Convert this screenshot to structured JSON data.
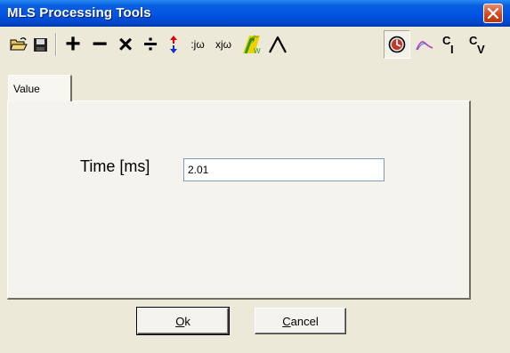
{
  "window": {
    "title": "MLS Processing Tools"
  },
  "toolbar": {
    "items": [
      {
        "name": "open-icon"
      },
      {
        "name": "save-icon"
      },
      {
        "name": "add-icon",
        "glyph": "+"
      },
      {
        "name": "subtract-icon",
        "glyph": "−"
      },
      {
        "name": "multiply-icon",
        "glyph": "×"
      },
      {
        "name": "divide-icon",
        "glyph": "÷"
      },
      {
        "name": "up-down-arrow-icon"
      },
      {
        "name": "divide-jw-icon",
        "glyph": ":jω"
      },
      {
        "name": "multiply-jw-icon",
        "glyph": "xjω"
      },
      {
        "name": "spl-weighting-icon",
        "glyph": "SPL W"
      },
      {
        "name": "window-curve-icon"
      },
      {
        "name": "time-clock-icon"
      },
      {
        "name": "smoothing-curve-icon"
      },
      {
        "name": "ci-icon",
        "glyph_top": "C",
        "glyph_sub": "I"
      },
      {
        "name": "cv-icon",
        "glyph_top": "C",
        "glyph_sub": "V"
      }
    ]
  },
  "tabs": [
    {
      "label": "Value"
    }
  ],
  "form": {
    "time_label": "Time [ms]",
    "time_value": "2.01"
  },
  "buttons": {
    "ok_prefix": "O",
    "ok_rest": "k",
    "cancel_prefix": "C",
    "cancel_rest": "ancel"
  }
}
